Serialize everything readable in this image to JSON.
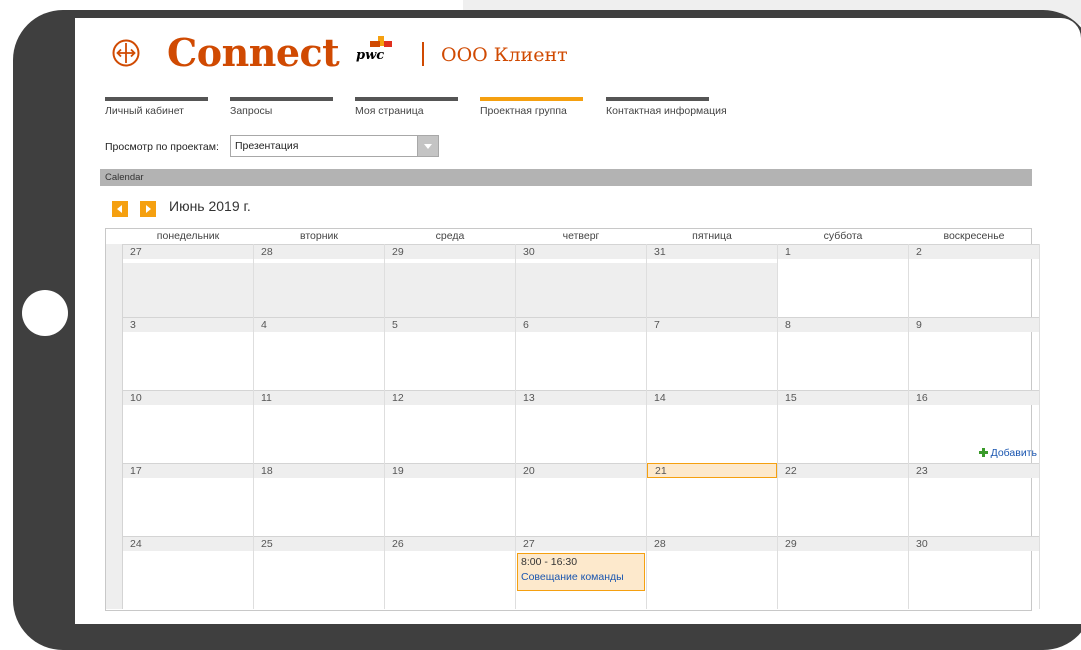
{
  "header": {
    "brand": "Connect",
    "pwc": "pwc",
    "client": "ООО Клиент"
  },
  "tabs": [
    {
      "label": "Личный кабинет",
      "active": false
    },
    {
      "label": "Запросы",
      "active": false
    },
    {
      "label": "Моя страница",
      "active": false
    },
    {
      "label": "Проектная группа",
      "active": true
    },
    {
      "label": "Контактная информация",
      "active": false
    }
  ],
  "project_filter": {
    "label": "Просмотр по проектам:",
    "selected": "Презентация"
  },
  "calendar": {
    "bar_title": "Calendar",
    "month": "Июнь 2019 г.",
    "weekdays": [
      "понедельник",
      "вторник",
      "среда",
      "четверг",
      "пятница",
      "суббота",
      "воскресенье"
    ],
    "weeks": [
      [
        "27",
        "28",
        "29",
        "30",
        "31",
        "1",
        "2"
      ],
      [
        "3",
        "4",
        "5",
        "6",
        "7",
        "8",
        "9"
      ],
      [
        "10",
        "11",
        "12",
        "13",
        "14",
        "15",
        "16"
      ],
      [
        "17",
        "18",
        "19",
        "20",
        "21",
        "22",
        "23"
      ],
      [
        "24",
        "25",
        "26",
        "27",
        "28",
        "29",
        "30"
      ]
    ],
    "today": "21",
    "add_label": "Добавить",
    "event": {
      "time": "8:00 - 16:30",
      "title": "Совещание команды",
      "day": "27"
    }
  },
  "colors": {
    "brand": "#d04a02",
    "accent": "#f5a010",
    "link": "#1a56b0",
    "device": "#3f3f3f"
  }
}
